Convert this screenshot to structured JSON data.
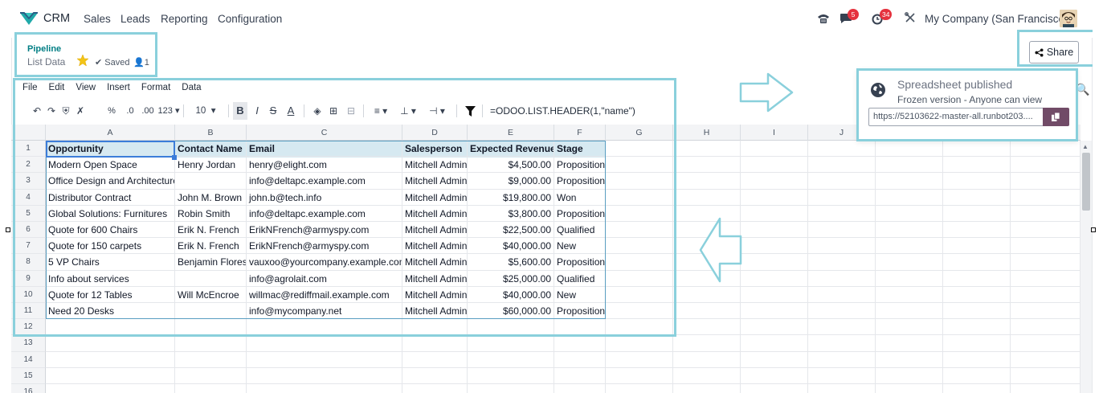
{
  "nav": {
    "app": "CRM",
    "menu": [
      "Sales",
      "Leads",
      "Reporting",
      "Configuration"
    ],
    "messages_count": "5",
    "activities_count": "34",
    "company": "My Company (San Francisco)"
  },
  "breadcrumb": {
    "link": "Pipeline",
    "title": "List Data",
    "saved": "Saved",
    "users": "1"
  },
  "share": {
    "label": "Share"
  },
  "menubar": [
    "File",
    "Edit",
    "View",
    "Insert",
    "Format",
    "Data"
  ],
  "toolbar": {
    "pct": "%",
    "dec_dec": ".0",
    "dec_inc": ".00",
    "num_fmt": "123",
    "font_size": "10",
    "bold": "B",
    "italic": "I",
    "strike": "S",
    "text_color": "A",
    "formula": "=ODOO.LIST.HEADER(1,\"name\")"
  },
  "grid": {
    "columns": [
      "A",
      "B",
      "C",
      "D",
      "E",
      "F",
      "G",
      "H",
      "I",
      "J"
    ],
    "headers": [
      "Opportunity",
      "Contact Name",
      "Email",
      "Salesperson",
      "Expected Revenue",
      "Stage"
    ],
    "rows": [
      [
        "Modern Open Space",
        "Henry Jordan",
        "henry@elight.com",
        "Mitchell Admin",
        "$4,500.00",
        "Proposition"
      ],
      [
        "Office Design and Architecture",
        "",
        "info@deltapc.example.com",
        "Mitchell Admin",
        "$9,000.00",
        "Proposition"
      ],
      [
        "Distributor Contract",
        "John M. Brown",
        "john.b@tech.info",
        "Mitchell Admin",
        "$19,800.00",
        "Won"
      ],
      [
        "Global Solutions: Furnitures",
        "Robin Smith",
        "info@deltapc.example.com",
        "Mitchell Admin",
        "$3,800.00",
        "Proposition"
      ],
      [
        "Quote for 600 Chairs",
        "Erik N. French",
        "ErikNFrench@armyspy.com",
        "Mitchell Admin",
        "$22,500.00",
        "Qualified"
      ],
      [
        "Quote for 150 carpets",
        "Erik N. French",
        "ErikNFrench@armyspy.com",
        "Mitchell Admin",
        "$40,000.00",
        "New"
      ],
      [
        "5 VP Chairs",
        "Benjamin Flores",
        "vauxoo@yourcompany.example.com",
        "Mitchell Admin",
        "$5,600.00",
        "Proposition"
      ],
      [
        "Info about services",
        "",
        "info@agrolait.com",
        "Mitchell Admin",
        "$25,000.00",
        "Qualified"
      ],
      [
        "Quote for 12 Tables",
        "Will McEncroe",
        "willmac@rediffmail.example.com",
        "Mitchell Admin",
        "$40,000.00",
        "New"
      ],
      [
        "Need 20 Desks",
        "",
        "info@mycompany.net",
        "Mitchell Admin",
        "$60,000.00",
        "Proposition"
      ]
    ],
    "row_numbers": [
      "1",
      "2",
      "3",
      "4",
      "5",
      "6",
      "7",
      "8",
      "9",
      "10",
      "11",
      "12",
      "13",
      "14",
      "15",
      "16"
    ]
  },
  "popover": {
    "title": "Spreadsheet published",
    "subtitle": "Frozen version - Anyone can view",
    "url": "https://52103622-master-all.runbot203...."
  },
  "colors": {
    "accent": "#8ad0dc",
    "odoo_purple": "#714b67",
    "teal": "#017e84",
    "badge": "#e5323e"
  }
}
